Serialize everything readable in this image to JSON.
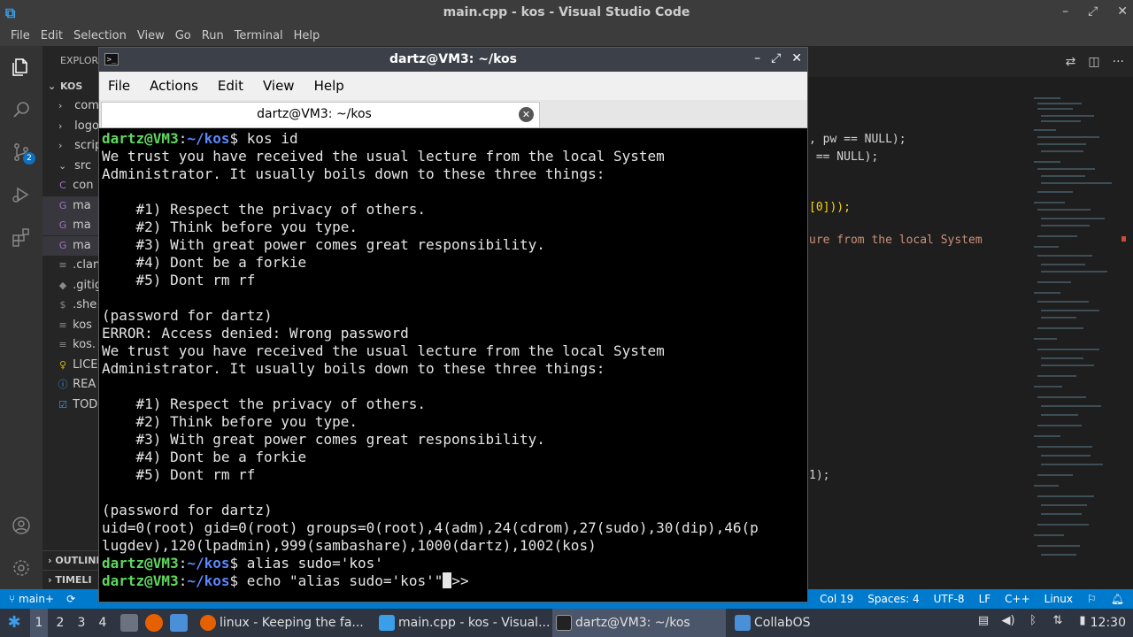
{
  "vscode": {
    "title": "main.cpp - kos - Visual Studio Code",
    "menu": [
      "File",
      "Edit",
      "Selection",
      "View",
      "Go",
      "Run",
      "Terminal",
      "Help"
    ],
    "scm_badge": "2",
    "explorer": {
      "header": "EXPLORER",
      "root": "KOS",
      "items": [
        {
          "chev": "›",
          "icon": "",
          "label": "com",
          "color": "#cccccc"
        },
        {
          "chev": "›",
          "icon": "",
          "label": "logo",
          "color": "#cccccc"
        },
        {
          "chev": "›",
          "icon": "",
          "label": "scrip",
          "color": "#cccccc"
        },
        {
          "chev": "⌄",
          "icon": "",
          "label": "src",
          "color": "#cccccc"
        },
        {
          "chev": "",
          "icon": "C",
          "label": "con",
          "color": "#cccccc"
        },
        {
          "chev": "",
          "icon": "G",
          "label": "ma",
          "color": "#cccccc"
        },
        {
          "chev": "",
          "icon": "G",
          "label": "ma",
          "color": "#cccccc"
        },
        {
          "chev": "",
          "icon": "G",
          "label": "ma",
          "color": "#cccccc"
        },
        {
          "chev": "",
          "icon": "≡",
          "label": ".clan",
          "color": "#cccccc"
        },
        {
          "chev": "",
          "icon": "◆",
          "label": ".gitig",
          "color": "#cccccc"
        },
        {
          "chev": "",
          "icon": "$",
          "label": ".she",
          "color": "#cccccc"
        },
        {
          "chev": "",
          "icon": "≡",
          "label": "kos",
          "color": "#cccccc"
        },
        {
          "chev": "",
          "icon": "≡",
          "label": "kos.",
          "color": "#cccccc"
        },
        {
          "chev": "",
          "icon": "♀",
          "label": "LICE",
          "color": "#cccccc"
        },
        {
          "chev": "",
          "icon": "ⓘ",
          "label": "REA",
          "color": "#cccccc"
        },
        {
          "chev": "",
          "icon": "☑",
          "label": "TOD",
          "color": "#cccccc"
        }
      ],
      "outline": "OUTLINE",
      "timeline": "TIMELI"
    },
    "code_fragments": [
      ", pw == NULL);",
      " == NULL);",
      "[0]));",
      "ure from the local System",
      "1);"
    ],
    "status": {
      "branch": "main+",
      "sync": "⟳",
      "cursor": "Col 19",
      "spaces": "Spaces: 4",
      "encoding": "UTF-8",
      "eol": "LF",
      "language": "C++",
      "os": "Linux"
    }
  },
  "terminal": {
    "title": "dartz@VM3: ~/kos",
    "menu": [
      "File",
      "Actions",
      "Edit",
      "View",
      "Help"
    ],
    "tab_label": "dartz@VM3: ~/kos",
    "lines": [
      {
        "kind": "prompt",
        "user": "dartz@VM3",
        "path": "~/kos",
        "cmd": " kos id"
      },
      {
        "kind": "text",
        "text": "We trust you have received the usual lecture from the local System"
      },
      {
        "kind": "text",
        "text": "Administrator. It usually boils down to these three things:"
      },
      {
        "kind": "text",
        "text": ""
      },
      {
        "kind": "text",
        "text": "    #1) Respect the privacy of others."
      },
      {
        "kind": "text",
        "text": "    #2) Think before you type."
      },
      {
        "kind": "text",
        "text": "    #3) With great power comes great responsibility."
      },
      {
        "kind": "text",
        "text": "    #4) Dont be a forkie"
      },
      {
        "kind": "text",
        "text": "    #5) Dont rm rf"
      },
      {
        "kind": "text",
        "text": ""
      },
      {
        "kind": "text",
        "text": "(password for dartz)"
      },
      {
        "kind": "text",
        "text": "ERROR: Access denied: Wrong password"
      },
      {
        "kind": "text",
        "text": "We trust you have received the usual lecture from the local System"
      },
      {
        "kind": "text",
        "text": "Administrator. It usually boils down to these three things:"
      },
      {
        "kind": "text",
        "text": ""
      },
      {
        "kind": "text",
        "text": "    #1) Respect the privacy of others."
      },
      {
        "kind": "text",
        "text": "    #2) Think before you type."
      },
      {
        "kind": "text",
        "text": "    #3) With great power comes great responsibility."
      },
      {
        "kind": "text",
        "text": "    #4) Dont be a forkie"
      },
      {
        "kind": "text",
        "text": "    #5) Dont rm rf"
      },
      {
        "kind": "text",
        "text": ""
      },
      {
        "kind": "text",
        "text": "(password for dartz)"
      },
      {
        "kind": "text",
        "text": "uid=0(root) gid=0(root) groups=0(root),4(adm),24(cdrom),27(sudo),30(dip),46(p"
      },
      {
        "kind": "text",
        "text": "lugdev),120(lpadmin),999(sambashare),1000(dartz),1002(kos)"
      },
      {
        "kind": "prompt",
        "user": "dartz@VM3",
        "path": "~/kos",
        "cmd": " alias sudo='kos'"
      },
      {
        "kind": "prompt_cursor",
        "user": "dartz@VM3",
        "path": "~/kos",
        "cmd": " echo \"alias sudo='kos'\"",
        "after": ">>"
      }
    ]
  },
  "taskbar": {
    "workspaces": [
      "1",
      "2",
      "3",
      "4"
    ],
    "tasks": [
      {
        "label": "linux - Keeping the fa...",
        "icon_color": "#e66000"
      },
      {
        "label": "main.cpp - kos - Visual...",
        "icon_color": "#3b9ee8"
      },
      {
        "label": "dartz@VM3: ~/kos",
        "icon_color": "#222222"
      },
      {
        "label": "CollabOS",
        "icon_color": "#4a90d9"
      }
    ],
    "clock": "12:30"
  }
}
